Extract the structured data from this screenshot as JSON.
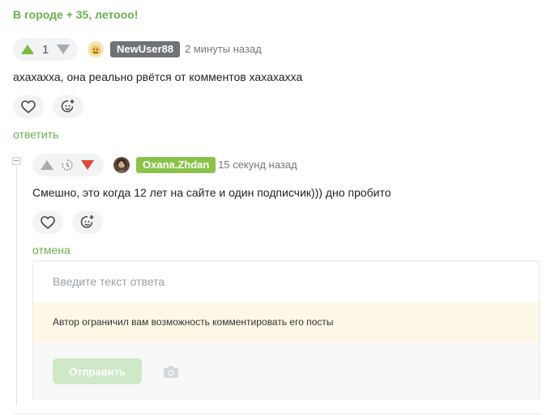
{
  "top_comment_text": "В городе + 35, летооо!",
  "comment1": {
    "votes": "1",
    "username": "NewUser88",
    "username_color": "#6f7276",
    "time": "2 минуты назад",
    "text": "ахахахха, она реально рвётся от комментов хахахахха",
    "reply_label": "ответить"
  },
  "comment2": {
    "username": "Oxana.Zhdan",
    "username_color": "#8bc34a",
    "time": "15 секунд назад",
    "text": "Смешно, это когда 12 лет на сайте и один подписчик))) дно пробито",
    "cancel_label": "отмена"
  },
  "reply_form": {
    "placeholder": "Введите текст ответа",
    "warning": "Автор ограничил вам возможность комментировать его посты",
    "send_label": "Отправить"
  },
  "colors": {
    "accent_green": "#6ab04c",
    "vote_up": "#7fb843",
    "vote_down": "#e0473d",
    "send_disabled": "#cfe8c8"
  }
}
